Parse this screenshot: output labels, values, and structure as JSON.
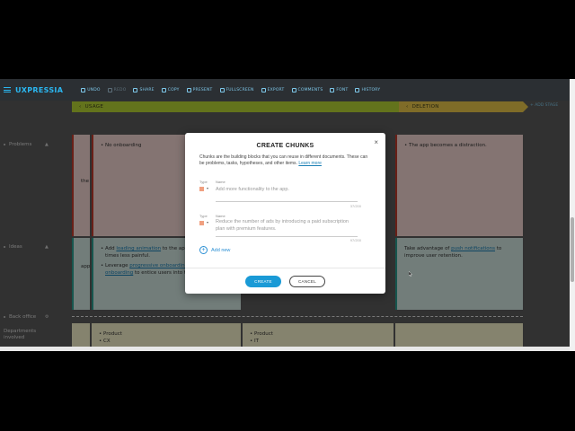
{
  "app": {
    "brand": "UXPRESSIA"
  },
  "toolbar": [
    {
      "label": "UNDO",
      "icon": "undo-icon",
      "disabled": false
    },
    {
      "label": "REDO",
      "icon": "redo-icon",
      "disabled": true
    },
    {
      "label": "SHARE",
      "icon": "share-icon",
      "disabled": false
    },
    {
      "label": "COPY",
      "icon": "copy-icon",
      "disabled": false
    },
    {
      "label": "PRESENT",
      "icon": "present-icon",
      "disabled": false
    },
    {
      "label": "FULLSCREEN",
      "icon": "fullscreen-icon",
      "disabled": false
    },
    {
      "label": "EXPORT",
      "icon": "export-icon",
      "disabled": false
    },
    {
      "label": "COMMENTS",
      "icon": "comments-icon",
      "disabled": false
    },
    {
      "label": "FONT",
      "icon": "font-icon",
      "disabled": false
    },
    {
      "label": "HISTORY",
      "icon": "history-icon",
      "disabled": false
    }
  ],
  "stages": {
    "usage": "USAGE",
    "deletion": "DELETION",
    "add_stage": "+ ADD STAGE"
  },
  "sidebar": {
    "problems": "Problems",
    "ideas": "Ideas",
    "back_office": "Back office",
    "departments": "Departments involved"
  },
  "cards": {
    "left_fragment": "the",
    "no_onboarding": "No onboarding",
    "distraction": "The app becomes a distraction.",
    "app_fragment": "app",
    "idea1_pre": "Add ",
    "idea1_link": "loading animation",
    "idea1_post": " to the app...",
    "idea1_line2": "times less painful.",
    "idea2_pre": "Leverage ",
    "idea2_link": "progressive onboarding",
    "idea2_link2": "onboarding",
    "idea2_post": " to entice users into t...",
    "push_pre": "Take advantage of ",
    "push_link": "push notifications",
    "push_post": " to improve user retention.",
    "dept_product": "Product",
    "dept_cx": "CX",
    "dept_it": "IT"
  },
  "modal": {
    "title": "CREATE CHUNKS",
    "close": "×",
    "description": "Chunks are the building blocks that you can reuse in different documents. These can be problems, tasks, hypotheses, and other items.",
    "learn_more": "Learn more",
    "type_label": "Type",
    "name_label": "Name",
    "rows": [
      {
        "value": "Add more functionality to the app.",
        "count": "37/200"
      },
      {
        "value": "Reduce the number of ads by introducing a paid subscription plan with premium features.",
        "count": "97/200"
      }
    ],
    "add_new": "Add new",
    "create": "CREATE",
    "cancel": "CANCEL"
  }
}
